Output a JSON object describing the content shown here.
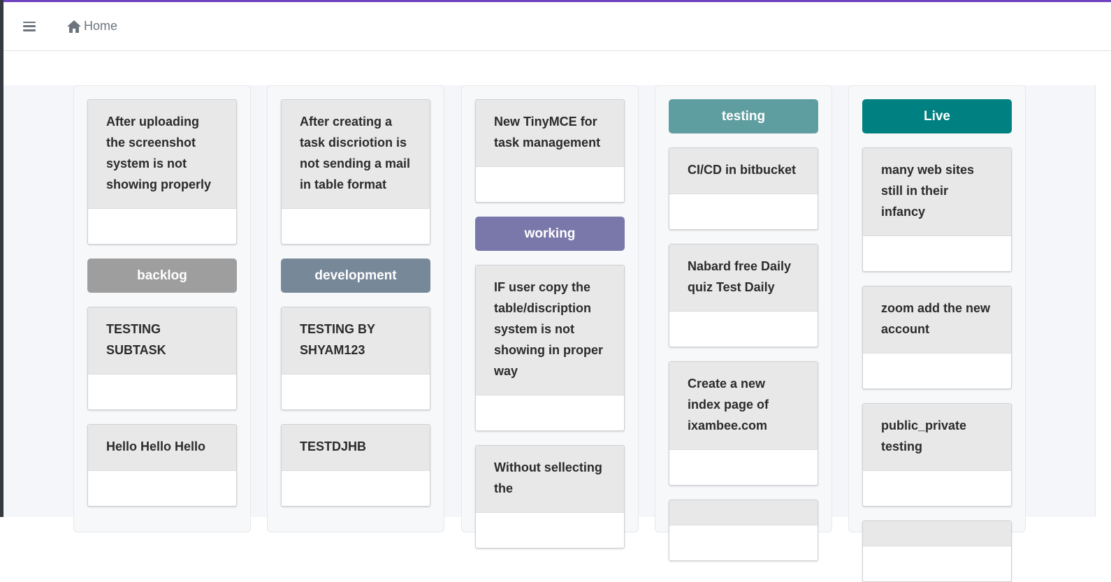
{
  "header": {
    "home_label": "Home"
  },
  "colors": {
    "accent": "#6f42c1",
    "backlog": "#9e9e9e",
    "development": "#778899",
    "working": "#7a78aa",
    "testing": "#5f9ea0",
    "live": "#008080"
  },
  "columns": [
    {
      "items": [
        {
          "card": "After uploading the screenshot system is not showing properly"
        },
        {
          "label": "backlog",
          "color": "#9e9e9e"
        },
        {
          "card": "TESTING SUBTASK"
        },
        {
          "card": "Hello Hello Hello"
        }
      ]
    },
    {
      "items": [
        {
          "card": "After creating a task discriotion is not sending a mail in table format"
        },
        {
          "label": "development",
          "color": "#778899"
        },
        {
          "card": "TESTING BY SHYAM123"
        },
        {
          "card": "TESTDJHB"
        }
      ]
    },
    {
      "items": [
        {
          "card": "New TinyMCE for task management"
        },
        {
          "label": "working",
          "color": "#7a78aa"
        },
        {
          "card": "IF user copy the table/discription system is not showing in proper way"
        },
        {
          "card": "Without sellecting the"
        }
      ]
    },
    {
      "items": [
        {
          "label": "testing",
          "color": "#5f9ea0"
        },
        {
          "card": "CI/CD in bitbucket"
        },
        {
          "card": "Nabard free Daily quiz Test Daily"
        },
        {
          "card": "Create a new index page of ixambee.com"
        },
        {
          "card": ""
        }
      ]
    },
    {
      "items": [
        {
          "label": "Live",
          "color": "#008080"
        },
        {
          "card": "many web sites still in their infancy"
        },
        {
          "card": "zoom add the new account"
        },
        {
          "card": "public_private testing"
        },
        {
          "card": ""
        }
      ]
    }
  ]
}
